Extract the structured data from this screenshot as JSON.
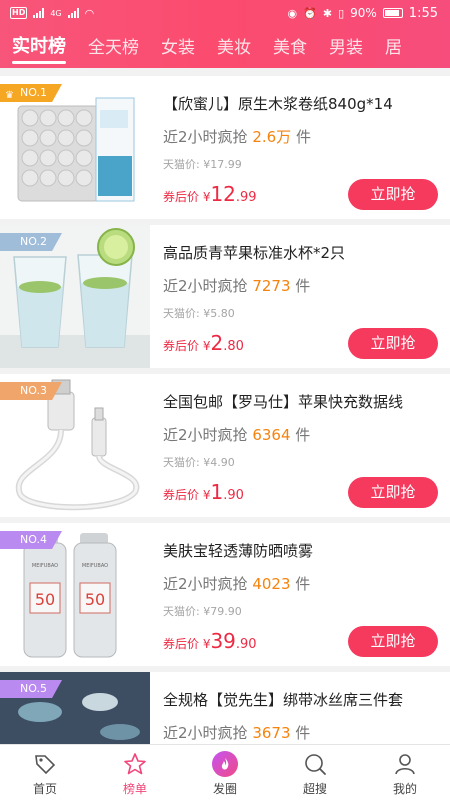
{
  "status_bar": {
    "left": "HD",
    "network": "4G",
    "battery": "90%",
    "time": "1:55"
  },
  "tabs": [
    "实时榜",
    "全天榜",
    "女装",
    "美妆",
    "美食",
    "男装",
    "居"
  ],
  "items": [
    {
      "rank": "NO.1",
      "rank_color": "#f5a623",
      "title": "【欣蜜儿】原生木浆卷纸840g*14",
      "sold_prefix": "近2小时疯抢",
      "sold_num": "2.6万",
      "sold_suffix": "件",
      "orig": "天猫价: ¥17.99",
      "price_label": "券后价 ¥",
      "price_int": "12",
      "price_dec": ".99",
      "buy": "立即抢"
    },
    {
      "rank": "NO.2",
      "rank_color": "#9fbcd9",
      "title": "高品质青苹果标准水杯*2只",
      "sold_prefix": "近2小时疯抢",
      "sold_num": "7273",
      "sold_suffix": "件",
      "orig": "天猫价: ¥5.80",
      "price_label": "券后价 ¥",
      "price_int": "2",
      "price_dec": ".80",
      "buy": "立即抢"
    },
    {
      "rank": "NO.3",
      "rank_color": "#f0a66a",
      "title": "全国包邮【罗马仕】苹果快充数据线",
      "sold_prefix": "近2小时疯抢",
      "sold_num": "6364",
      "sold_suffix": "件",
      "orig": "天猫价: ¥4.90",
      "price_label": "券后价 ¥",
      "price_int": "1",
      "price_dec": ".90",
      "buy": "立即抢"
    },
    {
      "rank": "NO.4",
      "rank_color": "#b98af0",
      "title": "美肤宝轻透薄防晒喷雾",
      "sold_prefix": "近2小时疯抢",
      "sold_num": "4023",
      "sold_suffix": "件",
      "orig": "天猫价: ¥79.90",
      "price_label": "券后价 ¥",
      "price_int": "39",
      "price_dec": ".90",
      "buy": "立即抢"
    },
    {
      "rank": "NO.5",
      "rank_color": "#b98af0",
      "title": "全规格【觉先生】绑带冰丝席三件套",
      "sold_prefix": "近2小时疯抢",
      "sold_num": "3673",
      "sold_suffix": "件",
      "orig": "",
      "price_label": "",
      "price_int": "",
      "price_dec": "",
      "buy": ""
    }
  ],
  "spray_label": "50",
  "spray_brand": "MEIFUBAO",
  "tabbar": [
    {
      "label": "首页",
      "icon": "tag-icon"
    },
    {
      "label": "榜单",
      "icon": "star-icon"
    },
    {
      "label": "发圈",
      "icon": "flame-icon"
    },
    {
      "label": "超搜",
      "icon": "search-icon"
    },
    {
      "label": "我的",
      "icon": "user-icon"
    }
  ],
  "colors": {
    "accent": "#f53a5e",
    "header_start": "#f8557a",
    "sold_num": "#f5830d",
    "price": "#ed2a44",
    "tab_active": "#f0467a"
  }
}
